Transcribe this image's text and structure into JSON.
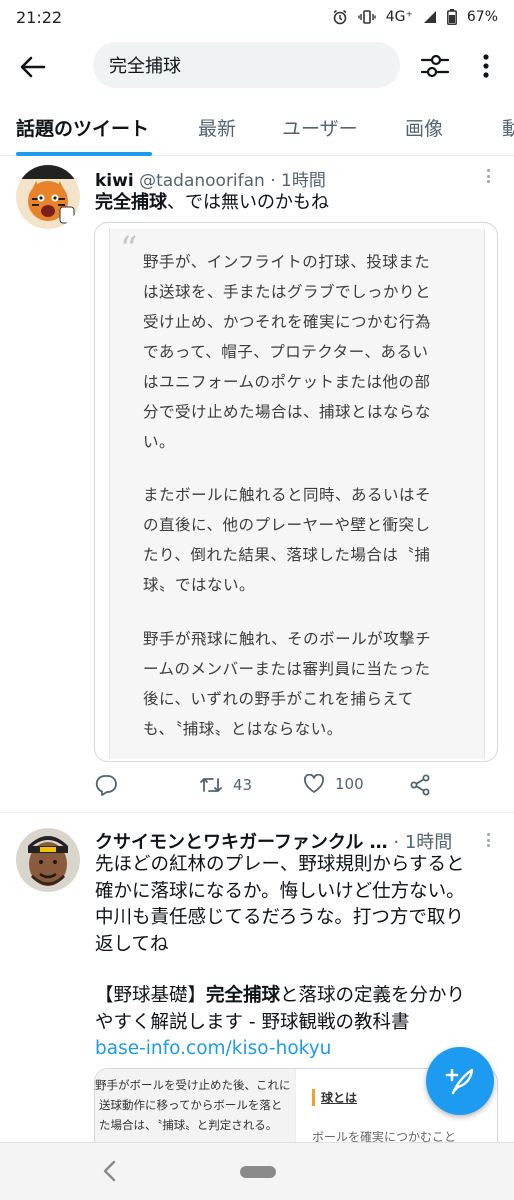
{
  "status_bar": {
    "time": "21:22",
    "network": "4G⁺",
    "battery": "67%"
  },
  "search": {
    "query": "完全捕球"
  },
  "tabs": [
    {
      "label": "話題のツイート",
      "active": true
    },
    {
      "label": "最新",
      "active": false
    },
    {
      "label": "ユーザー",
      "active": false
    },
    {
      "label": "画像",
      "active": false
    },
    {
      "label": "動",
      "active": false
    }
  ],
  "tweets": [
    {
      "name": "kiwi",
      "handle": "@tadanoorifan",
      "time": "· 1時間",
      "text_bold": "完全捕球",
      "text_rest": "、では無いのかもね",
      "quote_paragraphs": [
        [
          "野手が、インフライトの打球、投球また",
          "は送球を、手またはグラブでしっかりと",
          "受け止め、かつそれを確実につかむ行為",
          "であって、帽子、プロテクター、あるい",
          "はユニフォームのポケットまたは他の部",
          "分で受け止めた場合は、捕球とはならな",
          "い。"
        ],
        [
          "またボールに触れると同時、あるいはそ",
          "の直後に、他のプレーヤーや壁と衝突し",
          "たり、倒れた結果、落球した場合は〝捕",
          "球〟ではない。"
        ],
        [
          "野手が飛球に触れ、そのボールが攻撃チ",
          "ームのメンバーまたは審判員に当たった",
          "後に、いずれの野手がこれを捕らえて",
          "も、〝捕球〟とはならない。"
        ]
      ],
      "retweets": "43",
      "likes": "100"
    },
    {
      "name": "クサイモンとワキガーファンクル …",
      "time": "· 1時間",
      "lines": [
        "先ほどの紅林のプレー、野球規則からすると",
        "確かに落球になるか。悔しいけど仕方ない。",
        "中川も責任感じてるだろうな。打つ方で取り",
        "返してね"
      ],
      "article_prefix": "【野球基礎】",
      "article_bold": "完全捕球",
      "article_rest_line1": "と落球の定義を分かり",
      "article_line2": "やすく解説します - 野球観戦の教科書",
      "link": "base-info.com/kiso-hokyu",
      "preview_left_lines": [
        "野手がボールを受け止めた後、これに",
        "送球動作に移ってからボールを落と",
        "た場合は、〝捕球〟と判定される。"
      ],
      "preview_right_title": "球とは",
      "preview_right_text": "ボールを確実につかむこと"
    }
  ],
  "colors": {
    "accent": "#1d9bf0",
    "text_primary": "#0f1419",
    "text_secondary": "#536471"
  },
  "icons": [
    "back-arrow-icon",
    "filter-icon",
    "more-vertical-icon",
    "reply-icon",
    "retweet-icon",
    "like-icon",
    "share-icon",
    "compose-icon"
  ]
}
